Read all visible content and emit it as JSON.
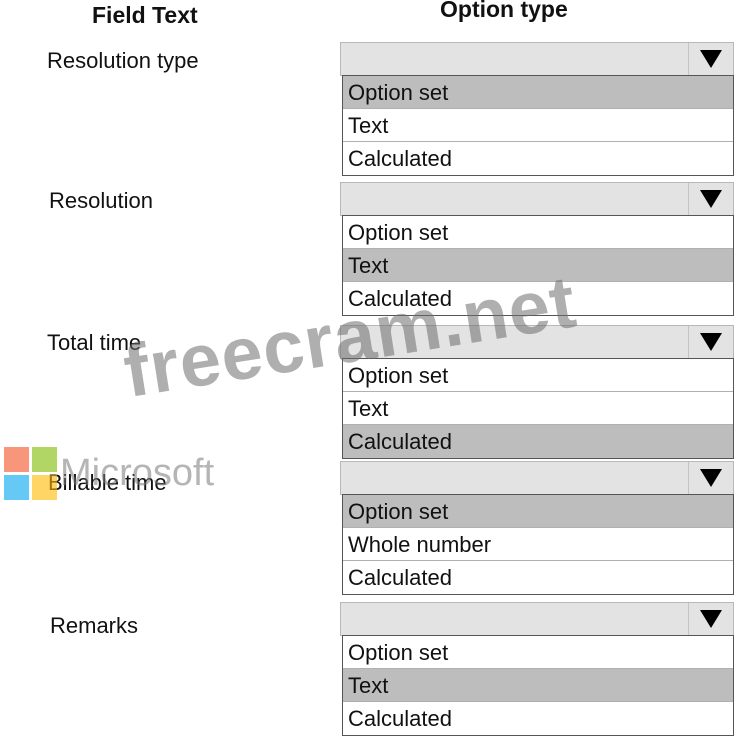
{
  "headers": {
    "field_text": "Field Text",
    "option_type": "Option type"
  },
  "rows": [
    {
      "label": "Resolution type",
      "selected": "",
      "options": [
        "Option set",
        "Text",
        "Calculated"
      ],
      "highlighted": 0
    },
    {
      "label": "Resolution",
      "selected": "",
      "options": [
        "Option set",
        "Text",
        "Calculated"
      ],
      "highlighted": 1
    },
    {
      "label": "Total time",
      "selected": "",
      "options": [
        "Option set",
        "Text",
        "Calculated"
      ],
      "highlighted": 2
    },
    {
      "label": "Billable time",
      "selected": "",
      "options": [
        "Option set",
        "Whole number",
        "Calculated"
      ],
      "highlighted": 0
    },
    {
      "label": "Remarks",
      "selected": "",
      "options": [
        "Option set",
        "Text",
        "Calculated"
      ],
      "highlighted": 1
    }
  ],
  "watermark": {
    "text": "freecram.net"
  },
  "logo": {
    "word": "Microsoft",
    "colors": [
      "#f25022",
      "#7fba00",
      "#00a4ef",
      "#ffb900"
    ]
  },
  "icons": {
    "dropdown": "triangle-down-icon"
  },
  "colors": {
    "highlight": "#bdbdbd",
    "dropdown_bg": "#e3e3e3"
  }
}
